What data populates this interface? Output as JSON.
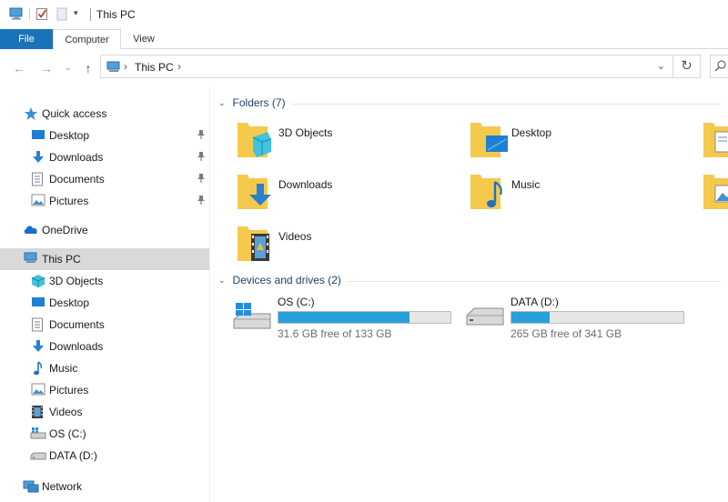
{
  "window": {
    "title": "This PC"
  },
  "ribbon": {
    "tabs": [
      {
        "label": "File"
      },
      {
        "label": "Computer"
      },
      {
        "label": "View"
      }
    ]
  },
  "address": {
    "location": "This PC"
  },
  "sidebar": {
    "quick_access": {
      "label": "Quick access"
    },
    "quick_items": [
      {
        "label": "Desktop",
        "icon": "desktop-icon"
      },
      {
        "label": "Downloads",
        "icon": "downloads-icon"
      },
      {
        "label": "Documents",
        "icon": "documents-icon"
      },
      {
        "label": "Pictures",
        "icon": "pictures-icon"
      }
    ],
    "onedrive": {
      "label": "OneDrive"
    },
    "thispc": {
      "label": "This PC"
    },
    "pc_items": [
      {
        "label": "3D Objects",
        "icon": "3d-objects-icon"
      },
      {
        "label": "Desktop",
        "icon": "desktop-icon"
      },
      {
        "label": "Documents",
        "icon": "documents-icon"
      },
      {
        "label": "Downloads",
        "icon": "downloads-icon"
      },
      {
        "label": "Music",
        "icon": "music-icon"
      },
      {
        "label": "Pictures",
        "icon": "pictures-icon"
      },
      {
        "label": "Videos",
        "icon": "videos-icon"
      },
      {
        "label": "OS (C:)",
        "icon": "drive-c-icon"
      },
      {
        "label": "DATA (D:)",
        "icon": "drive-d-icon"
      }
    ],
    "network": {
      "label": "Network"
    }
  },
  "content": {
    "folders_header": "Folders (7)",
    "folders": [
      {
        "label": "3D Objects"
      },
      {
        "label": "Desktop"
      },
      {
        "label": "Downloads"
      },
      {
        "label": "Music"
      },
      {
        "label": "Videos"
      }
    ],
    "drives_header": "Devices and drives (2)",
    "drives": [
      {
        "name": "OS (C:)",
        "free_text": "31.6 GB free of 133 GB",
        "used_fraction": 0.762
      },
      {
        "name": "DATA (D:)",
        "free_text": "265 GB free of 341 GB",
        "used_fraction": 0.223
      }
    ]
  },
  "colors": {
    "accent": "#1a73b8",
    "drive_fill": "#26a0da",
    "folder_yellow": "#f5c94c",
    "selection": "#d9d9d9"
  }
}
